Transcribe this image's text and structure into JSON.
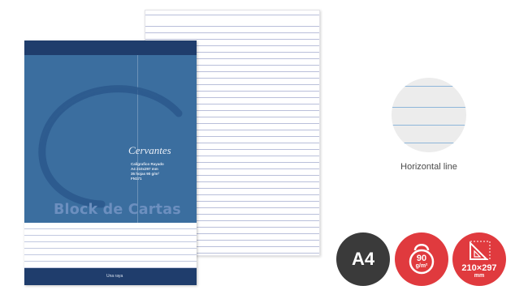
{
  "product": {
    "brand": "Cervantes",
    "title": "Block de Cartas",
    "spec_lines": [
      "Caligrafico Rayado",
      "A4 210x297 mm",
      "35 hojas 90 g/m²",
      "FN171"
    ],
    "ruling_label": "Una raya"
  },
  "sample": {
    "caption": "Horizontal line"
  },
  "badges": {
    "format": "A4",
    "weight_value": "90",
    "weight_unit": "g/m²",
    "size_value": "210×297",
    "size_unit": "mm"
  },
  "colors": {
    "cover_blue": "#3b6e9f",
    "cover_dark_blue": "#1f3d6c",
    "badge_red": "#e03a3e",
    "badge_dark": "#3a3a3a",
    "rule_line": "#8eb6da"
  },
  "icons": [
    "kettlebell-weight-icon",
    "set-square-size-icon"
  ]
}
